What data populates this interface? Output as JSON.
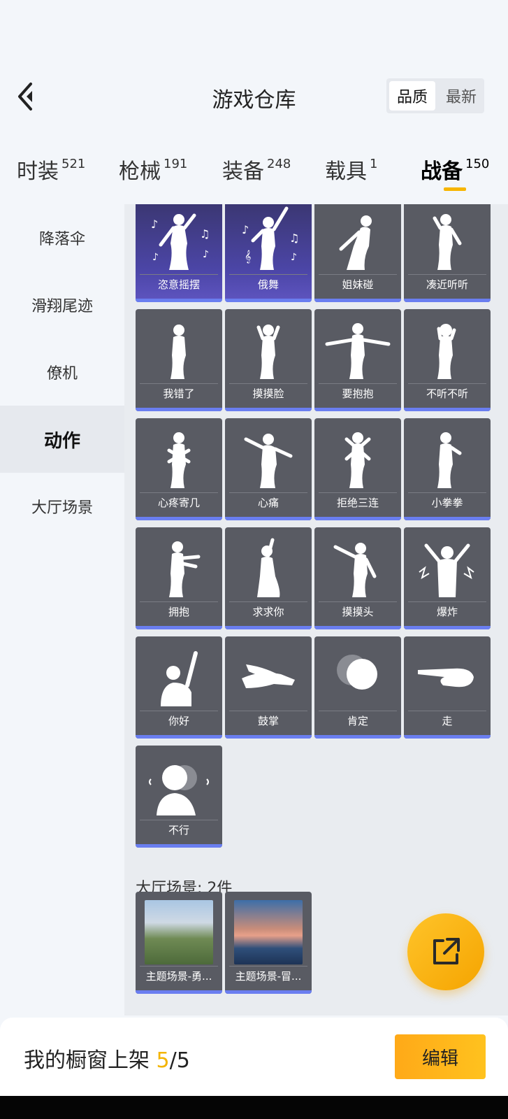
{
  "header": {
    "title": "游戏仓库",
    "sort_options": [
      "品质",
      "最新"
    ],
    "active_sort": "品质"
  },
  "category_tabs": [
    {
      "label": "时装",
      "count": "521",
      "active": false
    },
    {
      "label": "枪械",
      "count": "191",
      "active": false
    },
    {
      "label": "装备",
      "count": "248",
      "active": false
    },
    {
      "label": "载具",
      "count": "1",
      "active": false
    },
    {
      "label": "战备",
      "count": "150",
      "active": true
    }
  ],
  "sidebar": {
    "items": [
      {
        "label": "降落伞",
        "active": false
      },
      {
        "label": "滑翔尾迹",
        "active": false
      },
      {
        "label": "僚机",
        "active": false
      },
      {
        "label": "动作",
        "active": true
      },
      {
        "label": "大厅场景",
        "active": false
      }
    ]
  },
  "emotes": [
    {
      "label": "恣意摇摆",
      "rarity": "epic"
    },
    {
      "label": "俄舞",
      "rarity": "epic"
    },
    {
      "label": "姐妹碰",
      "rarity": "common"
    },
    {
      "label": "凑近听听",
      "rarity": "common"
    },
    {
      "label": "我错了",
      "rarity": "common"
    },
    {
      "label": "摸摸脸",
      "rarity": "common"
    },
    {
      "label": "要抱抱",
      "rarity": "common"
    },
    {
      "label": "不听不听",
      "rarity": "common"
    },
    {
      "label": "心疼寄几",
      "rarity": "common"
    },
    {
      "label": "心痛",
      "rarity": "common"
    },
    {
      "label": "拒绝三连",
      "rarity": "common"
    },
    {
      "label": "小拳拳",
      "rarity": "common"
    },
    {
      "label": "拥抱",
      "rarity": "common"
    },
    {
      "label": "求求你",
      "rarity": "common"
    },
    {
      "label": "摸摸头",
      "rarity": "common"
    },
    {
      "label": "爆炸",
      "rarity": "common"
    },
    {
      "label": "你好",
      "rarity": "common"
    },
    {
      "label": "鼓掌",
      "rarity": "common"
    },
    {
      "label": "肯定",
      "rarity": "common"
    },
    {
      "label": "走",
      "rarity": "common"
    },
    {
      "label": "不行",
      "rarity": "common"
    }
  ],
  "lobby_section": {
    "title": "大厅场景: 2件",
    "items": [
      {
        "label": "主题场景-勇..."
      },
      {
        "label": "主题场景-冒..."
      }
    ]
  },
  "bottom_bar": {
    "prefix": "我的橱窗上架 ",
    "current": "5",
    "separator": "/",
    "total": "5",
    "edit_label": "编辑"
  },
  "colors": {
    "accent": "#f7b500",
    "rarity_bar": "#6a7ef0",
    "card_bg": "#595b63",
    "epic_bg": "#4c46a8"
  }
}
